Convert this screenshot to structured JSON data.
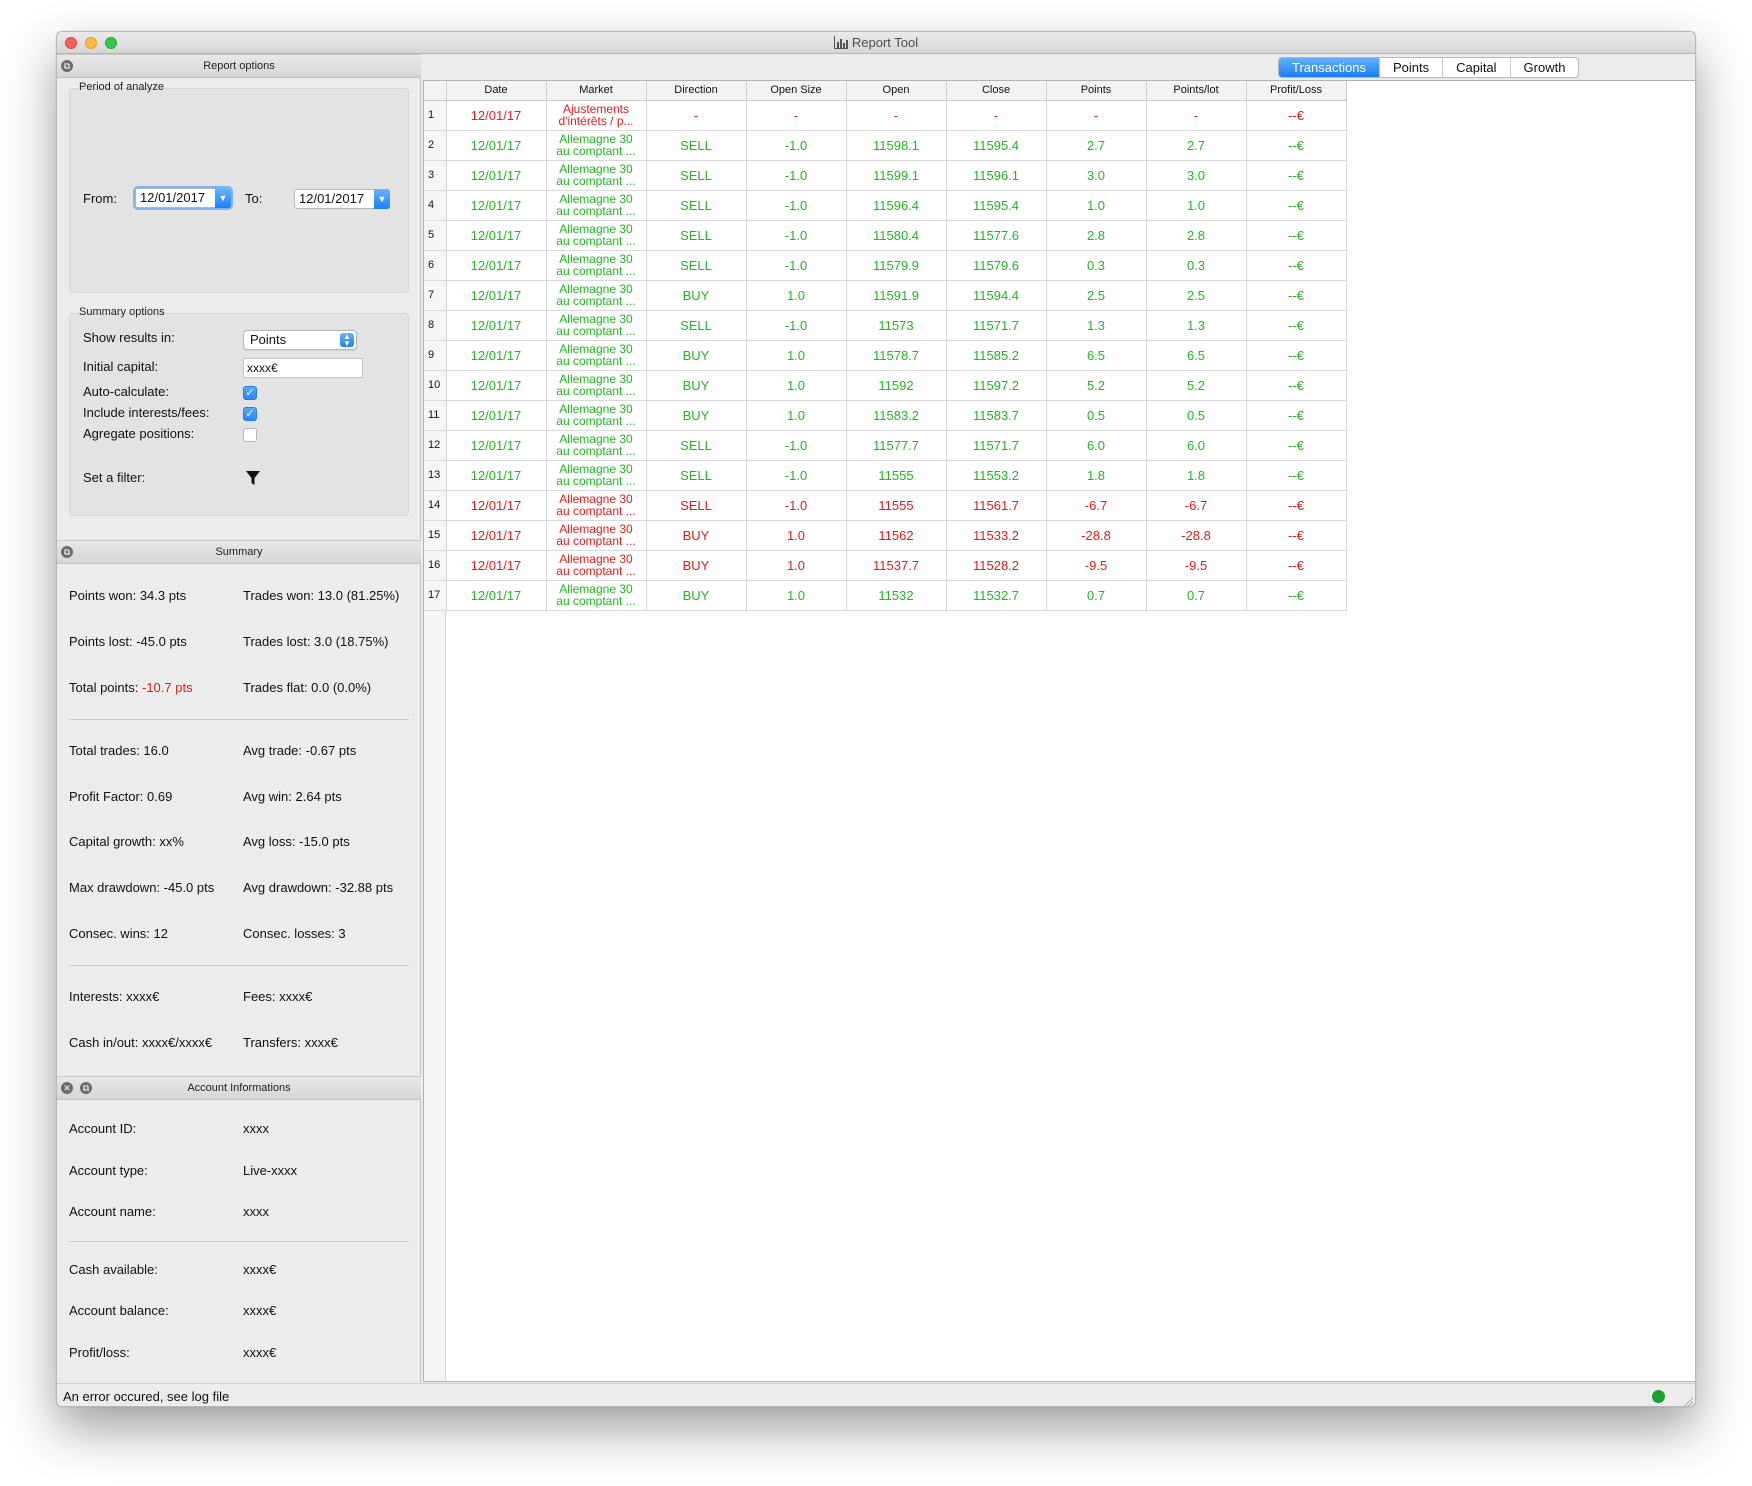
{
  "window": {
    "title": "Report Tool"
  },
  "report_options": {
    "header": "Report options",
    "period_title": "Period of analyze",
    "from_label": "From:",
    "from_value": "12/01/2017",
    "to_label": "To:",
    "to_value": "12/01/2017",
    "summary_title": "Summary options",
    "show_results_label": "Show results in:",
    "show_results_value": "Points",
    "initial_capital_label": "Initial capital:",
    "initial_capital_value": "xxxx€",
    "auto_calculate_label": "Auto-calculate:",
    "auto_calculate_checked": true,
    "include_interests_label": "Include interests/fees:",
    "include_interests_checked": true,
    "aggregate_label": "Agregate positions:",
    "aggregate_checked": false,
    "filter_label": "Set a filter:"
  },
  "summary": {
    "header": "Summary",
    "points_won": "Points won: 34.3 pts",
    "trades_won": "Trades won: 13.0 (81.25%)",
    "points_lost": "Points lost: -45.0 pts",
    "trades_lost": "Trades lost: 3.0 (18.75%)",
    "total_points_label": "Total points: ",
    "total_points_value": "-10.7 pts",
    "trades_flat": "Trades flat: 0.0 (0.0%)",
    "total_trades": "Total trades: 16.0",
    "avg_trade": "Avg trade: -0.67 pts",
    "profit_factor": "Profit Factor: 0.69",
    "avg_win": "Avg win: 2.64 pts",
    "capital_growth": "Capital growth: xx%",
    "avg_loss": "Avg loss: -15.0 pts",
    "max_drawdown": "Max drawdown: -45.0 pts",
    "avg_drawdown": "Avg drawdown: -32.88 pts",
    "consec_wins": "Consec. wins: 12",
    "consec_losses": "Consec. losses: 3",
    "interests": "Interests: xxxx€",
    "fees": "Fees: xxxx€",
    "cash_inout": "Cash in/out: xxxx€/xxxx€",
    "transfers": "Transfers: xxxx€"
  },
  "account": {
    "header": "Account Informations",
    "id_label": "Account ID:",
    "id_value": "xxxx",
    "type_label": "Account type:",
    "type_value": "Live-xxxx",
    "name_label": "Account name:",
    "name_value": "xxxx",
    "cash_label": "Cash available:",
    "cash_value": "xxxx€",
    "balance_label": "Account balance:",
    "balance_value": "xxxx€",
    "pl_label": "Profit/loss:",
    "pl_value": "xxxx€"
  },
  "tabs": [
    "Transactions",
    "Points",
    "Capital",
    "Growth"
  ],
  "active_tab": "Transactions",
  "table": {
    "columns": [
      "Date",
      "Market",
      "Direction",
      "Open Size",
      "Open",
      "Close",
      "Points",
      "Points/lot",
      "Profit/Loss"
    ],
    "rows": [
      {
        "n": "1",
        "date": "12/01/17",
        "market1": "Ajustements",
        "market2": "d'intérêts / p...",
        "direction": "-",
        "size": "-",
        "open": "-",
        "close": "-",
        "points": "-",
        "ppl": "-",
        "pl": "--€",
        "color": "red"
      },
      {
        "n": "2",
        "date": "12/01/17",
        "market1": "Allemagne 30",
        "market2": "au comptant ...",
        "direction": "SELL",
        "size": "-1.0",
        "open": "11598.1",
        "close": "11595.4",
        "points": "2.7",
        "ppl": "2.7",
        "pl": "--€",
        "color": "green"
      },
      {
        "n": "3",
        "date": "12/01/17",
        "market1": "Allemagne 30",
        "market2": "au comptant ...",
        "direction": "SELL",
        "size": "-1.0",
        "open": "11599.1",
        "close": "11596.1",
        "points": "3.0",
        "ppl": "3.0",
        "pl": "--€",
        "color": "green"
      },
      {
        "n": "4",
        "date": "12/01/17",
        "market1": "Allemagne 30",
        "market2": "au comptant ...",
        "direction": "SELL",
        "size": "-1.0",
        "open": "11596.4",
        "close": "11595.4",
        "points": "1.0",
        "ppl": "1.0",
        "pl": "--€",
        "color": "green"
      },
      {
        "n": "5",
        "date": "12/01/17",
        "market1": "Allemagne 30",
        "market2": "au comptant ...",
        "direction": "SELL",
        "size": "-1.0",
        "open": "11580.4",
        "close": "11577.6",
        "points": "2.8",
        "ppl": "2.8",
        "pl": "--€",
        "color": "green"
      },
      {
        "n": "6",
        "date": "12/01/17",
        "market1": "Allemagne 30",
        "market2": "au comptant ...",
        "direction": "SELL",
        "size": "-1.0",
        "open": "11579.9",
        "close": "11579.6",
        "points": "0.3",
        "ppl": "0.3",
        "pl": "--€",
        "color": "green"
      },
      {
        "n": "7",
        "date": "12/01/17",
        "market1": "Allemagne 30",
        "market2": "au comptant ...",
        "direction": "BUY",
        "size": "1.0",
        "open": "11591.9",
        "close": "11594.4",
        "points": "2.5",
        "ppl": "2.5",
        "pl": "--€",
        "color": "green"
      },
      {
        "n": "8",
        "date": "12/01/17",
        "market1": "Allemagne 30",
        "market2": "au comptant ...",
        "direction": "SELL",
        "size": "-1.0",
        "open": "11573",
        "close": "11571.7",
        "points": "1.3",
        "ppl": "1.3",
        "pl": "--€",
        "color": "green"
      },
      {
        "n": "9",
        "date": "12/01/17",
        "market1": "Allemagne 30",
        "market2": "au comptant ...",
        "direction": "BUY",
        "size": "1.0",
        "open": "11578.7",
        "close": "11585.2",
        "points": "6.5",
        "ppl": "6.5",
        "pl": "--€",
        "color": "green"
      },
      {
        "n": "10",
        "date": "12/01/17",
        "market1": "Allemagne 30",
        "market2": "au comptant ...",
        "direction": "BUY",
        "size": "1.0",
        "open": "11592",
        "close": "11597.2",
        "points": "5.2",
        "ppl": "5.2",
        "pl": "--€",
        "color": "green"
      },
      {
        "n": "11",
        "date": "12/01/17",
        "market1": "Allemagne 30",
        "market2": "au comptant ...",
        "direction": "BUY",
        "size": "1.0",
        "open": "11583.2",
        "close": "11583.7",
        "points": "0.5",
        "ppl": "0.5",
        "pl": "--€",
        "color": "green"
      },
      {
        "n": "12",
        "date": "12/01/17",
        "market1": "Allemagne 30",
        "market2": "au comptant ...",
        "direction": "SELL",
        "size": "-1.0",
        "open": "11577.7",
        "close": "11571.7",
        "points": "6.0",
        "ppl": "6.0",
        "pl": "--€",
        "color": "green"
      },
      {
        "n": "13",
        "date": "12/01/17",
        "market1": "Allemagne 30",
        "market2": "au comptant ...",
        "direction": "SELL",
        "size": "-1.0",
        "open": "11555",
        "close": "11553.2",
        "points": "1.8",
        "ppl": "1.8",
        "pl": "--€",
        "color": "green"
      },
      {
        "n": "14",
        "date": "12/01/17",
        "market1": "Allemagne 30",
        "market2": "au comptant ...",
        "direction": "SELL",
        "size": "-1.0",
        "open": "11555",
        "close": "11561.7",
        "points": "-6.7",
        "ppl": "-6.7",
        "pl": "--€",
        "color": "red"
      },
      {
        "n": "15",
        "date": "12/01/17",
        "market1": "Allemagne 30",
        "market2": "au comptant ...",
        "direction": "BUY",
        "size": "1.0",
        "open": "11562",
        "close": "11533.2",
        "points": "-28.8",
        "ppl": "-28.8",
        "pl": "--€",
        "color": "red"
      },
      {
        "n": "16",
        "date": "12/01/17",
        "market1": "Allemagne 30",
        "market2": "au comptant ...",
        "direction": "BUY",
        "size": "1.0",
        "open": "11537.7",
        "close": "11528.2",
        "points": "-9.5",
        "ppl": "-9.5",
        "pl": "--€",
        "color": "red"
      },
      {
        "n": "17",
        "date": "12/01/17",
        "market1": "Allemagne 30",
        "market2": "au comptant ...",
        "direction": "BUY",
        "size": "1.0",
        "open": "11532",
        "close": "11532.7",
        "points": "0.7",
        "ppl": "0.7",
        "pl": "--€",
        "color": "green"
      }
    ]
  },
  "status": {
    "message": "An error occured, see log file",
    "indicator_color": "#17a12f"
  },
  "colors": {
    "positive": "#22b422",
    "negative": "#dd1c1c",
    "accent": "#1a7ff5"
  }
}
